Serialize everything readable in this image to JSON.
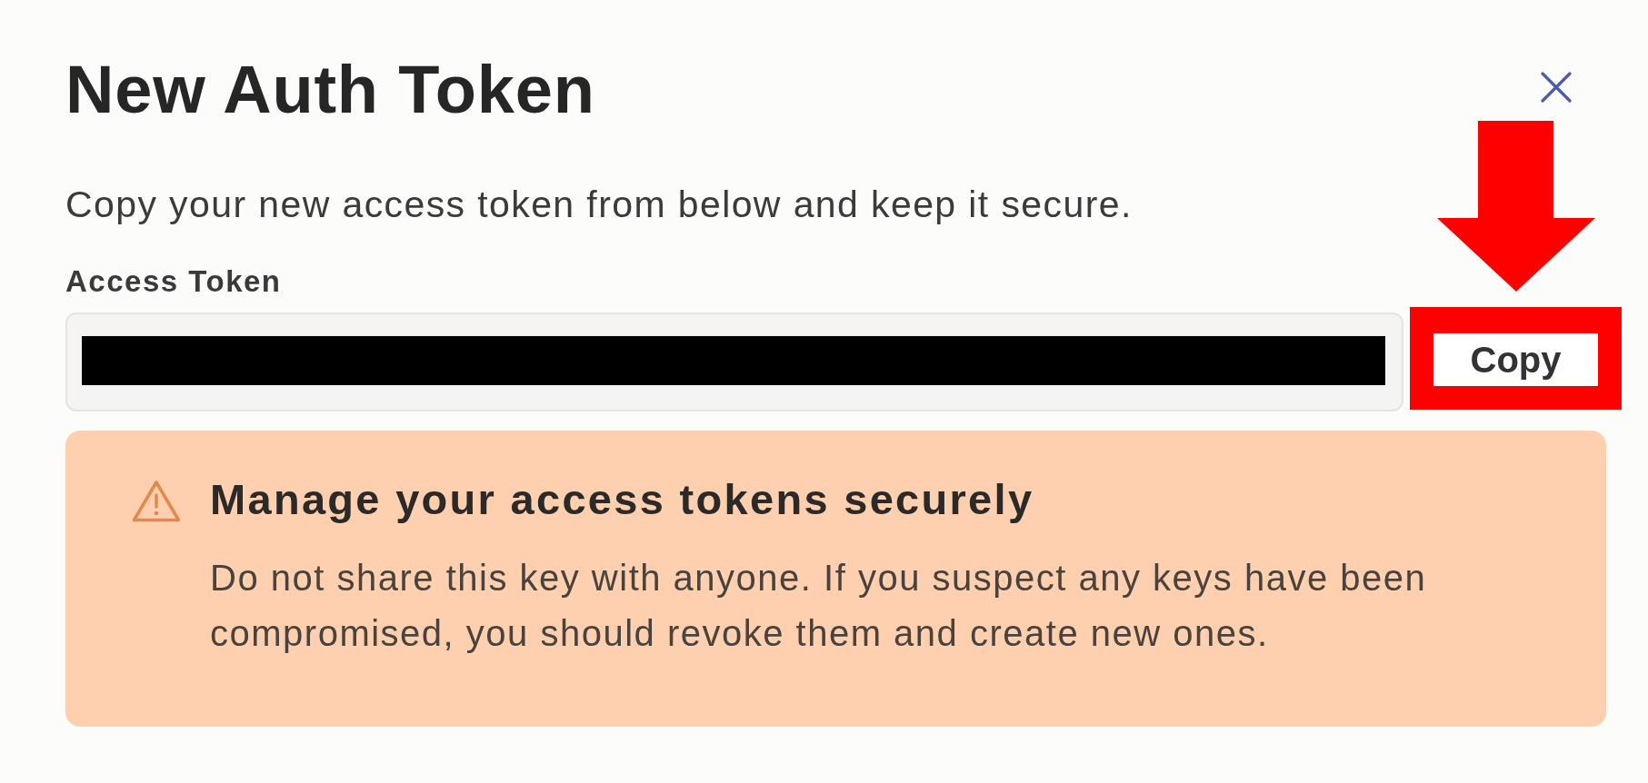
{
  "dialog": {
    "title": "New Auth Token",
    "description": "Copy your new access token from below and keep it secure."
  },
  "token_field": {
    "label": "Access Token",
    "redacted": true,
    "copy_button": "Copy"
  },
  "warning": {
    "title": "Manage your access tokens securely",
    "body": "Do not share this key with anyone. If you suspect any keys have been compromised, you should revoke them and create new ones."
  },
  "annotations": {
    "arrow": true,
    "highlight": true
  }
}
